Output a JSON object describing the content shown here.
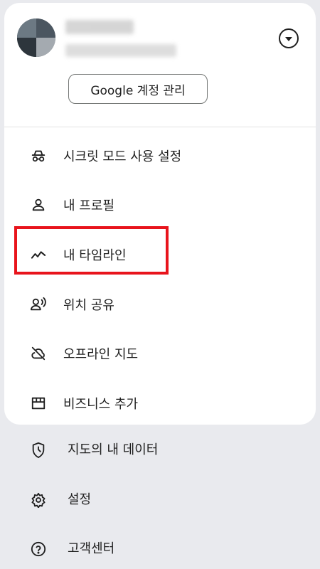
{
  "account": {
    "manage_button_label": "Google 계정 관리",
    "expand_icon": "chevron-down-circle-icon"
  },
  "card_menu": [
    {
      "id": "incognito",
      "label": "시크릿 모드 사용 설정",
      "icon": "incognito-icon"
    },
    {
      "id": "profile",
      "label": "내 프로필",
      "icon": "person-icon"
    },
    {
      "id": "timeline",
      "label": "내 타임라인",
      "icon": "timeline-icon"
    },
    {
      "id": "location-sharing",
      "label": "위치 공유",
      "icon": "location-sharing-icon"
    },
    {
      "id": "offline-maps",
      "label": "오프라인 지도",
      "icon": "cloud-off-icon"
    },
    {
      "id": "add-business",
      "label": "비즈니스 추가",
      "icon": "storefront-icon"
    }
  ],
  "outer_menu": [
    {
      "id": "your-data",
      "label": "지도의 내 데이터",
      "icon": "shield-data-icon"
    },
    {
      "id": "settings",
      "label": "설정",
      "icon": "gear-icon"
    },
    {
      "id": "help",
      "label": "고객센터",
      "icon": "help-circle-icon"
    }
  ],
  "colors": {
    "highlight": "#e8141c",
    "card_background": "#ffffff",
    "page_background": "#e9eaee"
  }
}
